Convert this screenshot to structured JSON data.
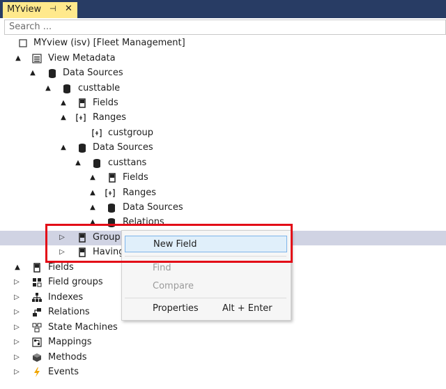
{
  "tab": {
    "title": "MYview",
    "pin_glyph": "⊣",
    "close_glyph": "✕"
  },
  "search": {
    "placeholder": "Search ..."
  },
  "tree": [
    {
      "label": "MYview (isv) [Fleet Management]",
      "icon": "view-root-icon",
      "arrow": ""
    },
    {
      "label": "View Metadata",
      "icon": "metadata-icon",
      "arrow": "▲"
    },
    {
      "label": "Data Sources",
      "icon": "datasource-icon",
      "arrow": "▲"
    },
    {
      "label": "custtable",
      "icon": "datasource-icon",
      "arrow": "▲"
    },
    {
      "label": "Fields",
      "icon": "field-icon",
      "arrow": "▲"
    },
    {
      "label": "Ranges",
      "icon": "range-icon",
      "arrow": "▲"
    },
    {
      "label": "custgroup",
      "icon": "range-icon",
      "arrow": ""
    },
    {
      "label": "Data Sources",
      "icon": "datasource-icon",
      "arrow": "▲"
    },
    {
      "label": "custtans",
      "icon": "datasource-icon",
      "arrow": "▲"
    },
    {
      "label": "Fields",
      "icon": "field-icon",
      "arrow": "▲"
    },
    {
      "label": "Ranges",
      "icon": "range-icon",
      "arrow": "▲"
    },
    {
      "label": "Data Sources",
      "icon": "datasource-icon",
      "arrow": "▲"
    },
    {
      "label": "Relations",
      "icon": "datasource-icon",
      "arrow": "▲"
    },
    {
      "label": "Group",
      "icon": "field-icon",
      "arrow": "▷"
    },
    {
      "label": "Having",
      "icon": "field-icon",
      "arrow": "▷"
    },
    {
      "label": "Fields",
      "icon": "field-icon",
      "arrow": "▲"
    },
    {
      "label": "Field groups",
      "icon": "field-groups-icon",
      "arrow": "▷"
    },
    {
      "label": "Indexes",
      "icon": "indexes-icon",
      "arrow": "▷"
    },
    {
      "label": "Relations",
      "icon": "relations-icon",
      "arrow": "▷"
    },
    {
      "label": "State Machines",
      "icon": "state-machines-icon",
      "arrow": "▷"
    },
    {
      "label": "Mappings",
      "icon": "mappings-icon",
      "arrow": "▷"
    },
    {
      "label": "Methods",
      "icon": "methods-icon",
      "arrow": "▷"
    },
    {
      "label": "Events",
      "icon": "events-icon",
      "arrow": "▷"
    }
  ],
  "context_menu": {
    "items": [
      {
        "label": "New Field",
        "state": "hovered"
      },
      {
        "label": "Find",
        "state": "disabled"
      },
      {
        "label": "Compare",
        "state": "disabled"
      },
      {
        "label": "Properties",
        "shortcut": "Alt + Enter",
        "state": "enabled"
      }
    ]
  },
  "colors": {
    "title_bar": "#283c64",
    "tab": "#ffe98c",
    "highlight_row": "#d0d3e3",
    "menu_hover": "#e0effa",
    "annotation": "#e30b17"
  }
}
